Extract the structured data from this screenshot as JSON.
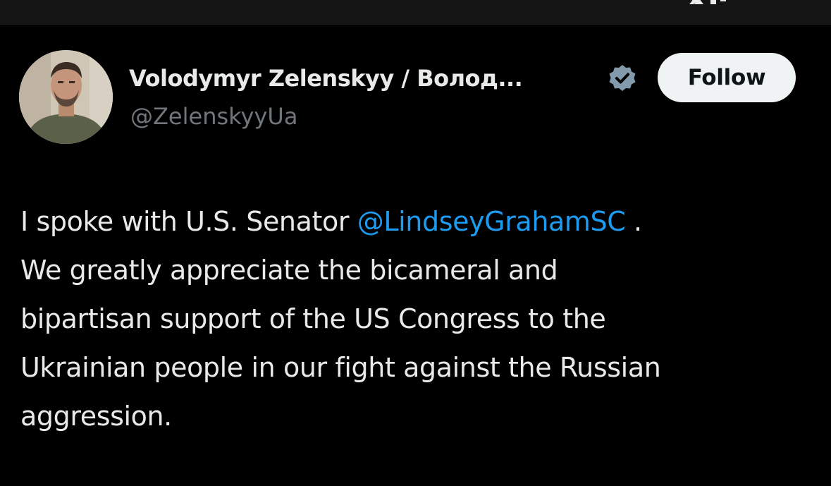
{
  "author": {
    "display_name": "Volodymyr Zelenskyy / Волод...",
    "handle": "@ZelenskyyUa",
    "verified": true
  },
  "follow_button_label": "Follow",
  "tweet": {
    "line1_prefix": "I spoke with U.S. Senator ",
    "mention": "@LindseyGrahamSC",
    "line1_suffix": " .",
    "line2": "We greatly appreciate the bicameral and",
    "line3": "bipartisan support of the US Congress to the",
    "line4": "Ukrainian people in our fight against the Russian",
    "line5": "aggression."
  },
  "colors": {
    "background": "#000000",
    "text_primary": "#e7e9ea",
    "text_secondary": "#71767b",
    "link": "#1d9bf0",
    "follow_button_bg": "#eff3f4",
    "verified_badge": "#829aab"
  },
  "icons": {
    "top_logo": "x-logo-icon",
    "verified": "verified-badge-icon"
  }
}
